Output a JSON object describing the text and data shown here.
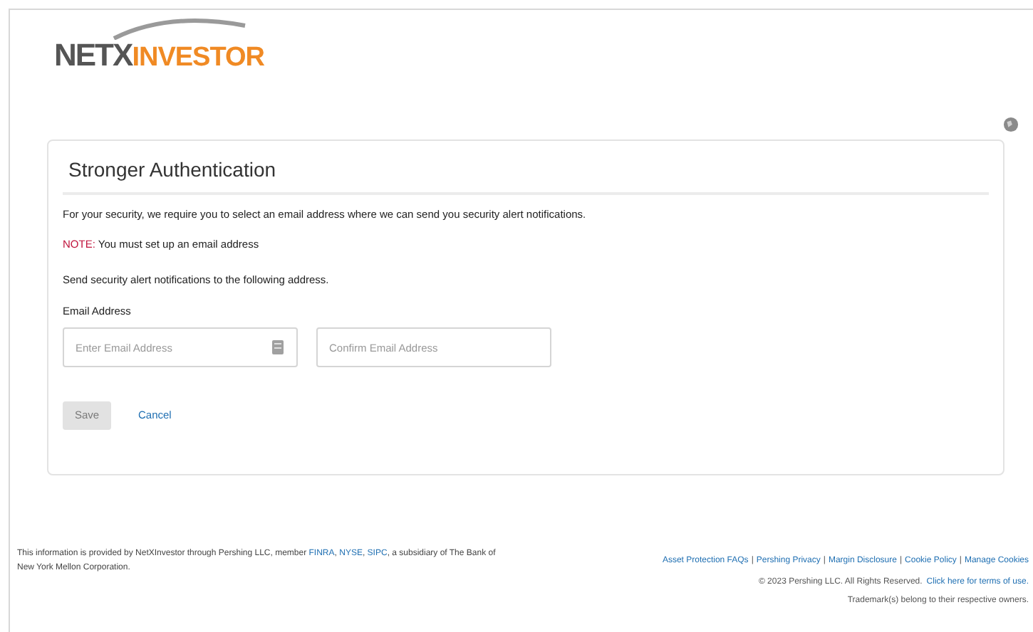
{
  "header": {
    "logo": {
      "part_1": "NETX",
      "part_2": "INVESTOR"
    }
  },
  "card": {
    "title": "Stronger Authentication",
    "intro": "For your security, we require you to select an email address where we can send you security alert notifications.",
    "note": {
      "label": "NOTE:",
      "text": "You must set up an email address"
    },
    "instruction": "Send security alert notifications to the following address.",
    "field_label": "Email Address",
    "fields": [
      {
        "placeholder": "Enter Email Address",
        "kind": "with-icon"
      },
      {
        "placeholder": "Confirm Email Address",
        "kind": "plain"
      }
    ],
    "save_button": {
      "label": "Save",
      "disabled": true
    },
    "cancel_link": "Cancel"
  },
  "footer": {
    "disclaimer": [
      {
        "text": "This information is provided by NetXInvestor through Pershing LLC, member ",
        "kind": "text"
      },
      {
        "text": "FINRA",
        "kind": "link"
      },
      {
        "text": ", ",
        "kind": "text"
      },
      {
        "text": "NYSE",
        "kind": "link"
      },
      {
        "text": ", ",
        "kind": "text"
      },
      {
        "text": "SIPC",
        "kind": "link"
      },
      {
        "text": ", a subsidiary of The Bank of New York Mellon Corporation.",
        "kind": "text"
      }
    ],
    "links": [
      "Asset Protection FAQs",
      "Pershing Privacy",
      "Margin Disclosure",
      "Cookie Policy",
      "Manage Cookies"
    ],
    "separator": "|",
    "copyright": "© 2023 Pershing LLC. All Rights Reserved.",
    "terms_link": "Click here for terms of use.",
    "trademark": "Trademark(s) belong to their respective owners."
  }
}
